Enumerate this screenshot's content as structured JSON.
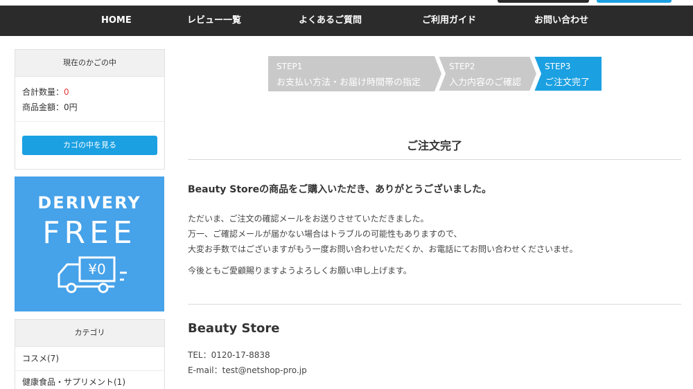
{
  "nav": {
    "items": [
      "HOME",
      "レビュー一覧",
      "よくあるご質問",
      "ご利用ガイド",
      "お問い合わせ"
    ]
  },
  "cart": {
    "title": "現在のかごの中",
    "qty_label": "合計数量：",
    "qty_value": "0",
    "amount_label": "商品金額：",
    "amount_value": "0円",
    "button_label": "カゴの中を見る"
  },
  "banner": {
    "line1": "DERIVERY",
    "line2": "FREE",
    "truck_label": "¥0"
  },
  "category": {
    "title": "カテゴリ",
    "items": [
      "コスメ(7)",
      "健康食品・サプリメント(1)"
    ]
  },
  "steps": [
    {
      "num": "STEP1",
      "label": "お支払い方法・お届け時間帯の指定",
      "state": "done"
    },
    {
      "num": "STEP2",
      "label": "入力内容のご確認",
      "state": "done"
    },
    {
      "num": "STEP3",
      "label": "ご注文完了",
      "state": "active"
    }
  ],
  "main": {
    "heading": "ご注文完了",
    "thanks": "Beauty Storeの商品をご購入いただき、ありがとうございました。",
    "paragraph": [
      "ただいま、ご注文の確認メールをお送りさせていただきました。",
      "万一、ご確認メールが届かない場合はトラブルの可能性もありますので、",
      "大変お手数ではございますがもう一度お問い合わせいただくか、お電話にてお問い合わせくださいませ。"
    ],
    "closing": "今後ともご愛顧賜りますようよろしくお願い申し上げます。"
  },
  "store": {
    "name": "Beauty Store",
    "tel": "TEL：0120-17-8838",
    "email": "E-mail：test@netshop-pro.jp"
  },
  "colors": {
    "accent": "#1ba0e2",
    "nav_bg": "#2b2b2b",
    "banner_bg": "#46a2e9",
    "step_done": "#c9c9c9",
    "step_active": "#1ba0e2",
    "red": "#e23b3b"
  }
}
